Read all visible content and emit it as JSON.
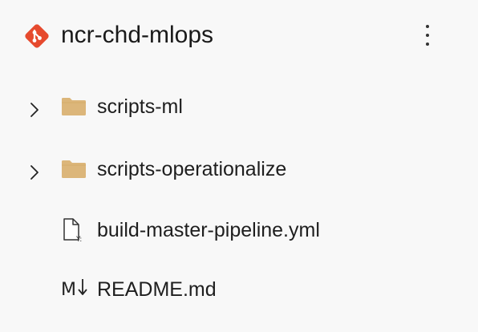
{
  "repo": {
    "name": "ncr-chd-mlops",
    "icon": "git-repo-icon",
    "accent_color": "#e64a2e"
  },
  "header": {
    "more_icon": "more-vertical-icon"
  },
  "tree": {
    "items": [
      {
        "label": "scripts-ml",
        "kind": "folder",
        "expanded": false,
        "icon": "folder-icon"
      },
      {
        "label": "scripts-operationalize",
        "kind": "folder",
        "expanded": false,
        "icon": "folder-icon"
      },
      {
        "label": "build-master-pipeline.yml",
        "kind": "file",
        "icon": "yaml-file-icon"
      },
      {
        "label": "README.md",
        "kind": "file",
        "icon": "markdown-icon"
      }
    ],
    "folder_color": "#dcb67a"
  }
}
